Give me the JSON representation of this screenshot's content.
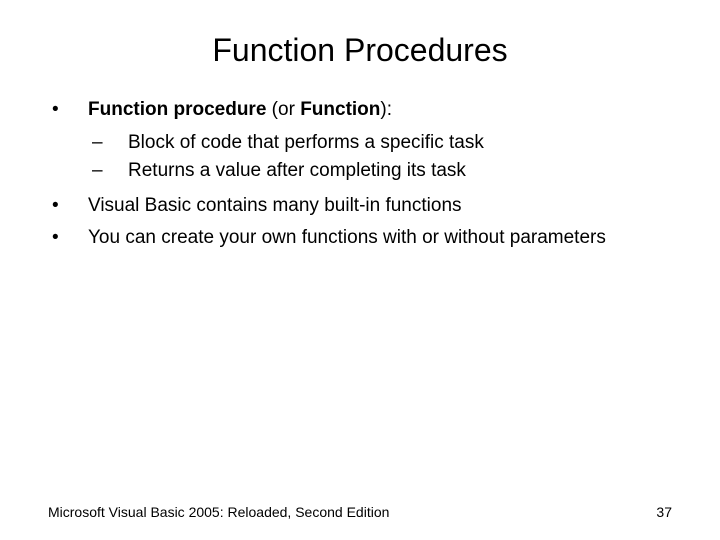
{
  "title": "Function Procedures",
  "bullets": {
    "b1": {
      "mark": "•",
      "bold1": "Function procedure",
      "mid": " (or ",
      "bold2": "Function",
      "tail": "):"
    },
    "sub1": {
      "mark": "–",
      "text": "Block of code that performs a specific task"
    },
    "sub2": {
      "mark": "–",
      "text": "Returns a value after completing its task"
    },
    "b2": {
      "mark": "•",
      "text": "Visual Basic contains many built-in functions"
    },
    "b3": {
      "mark": "•",
      "text": "You can create your own functions with or without parameters"
    }
  },
  "footer": {
    "text": "Microsoft Visual Basic 2005: Reloaded, Second Edition",
    "page": "37"
  }
}
